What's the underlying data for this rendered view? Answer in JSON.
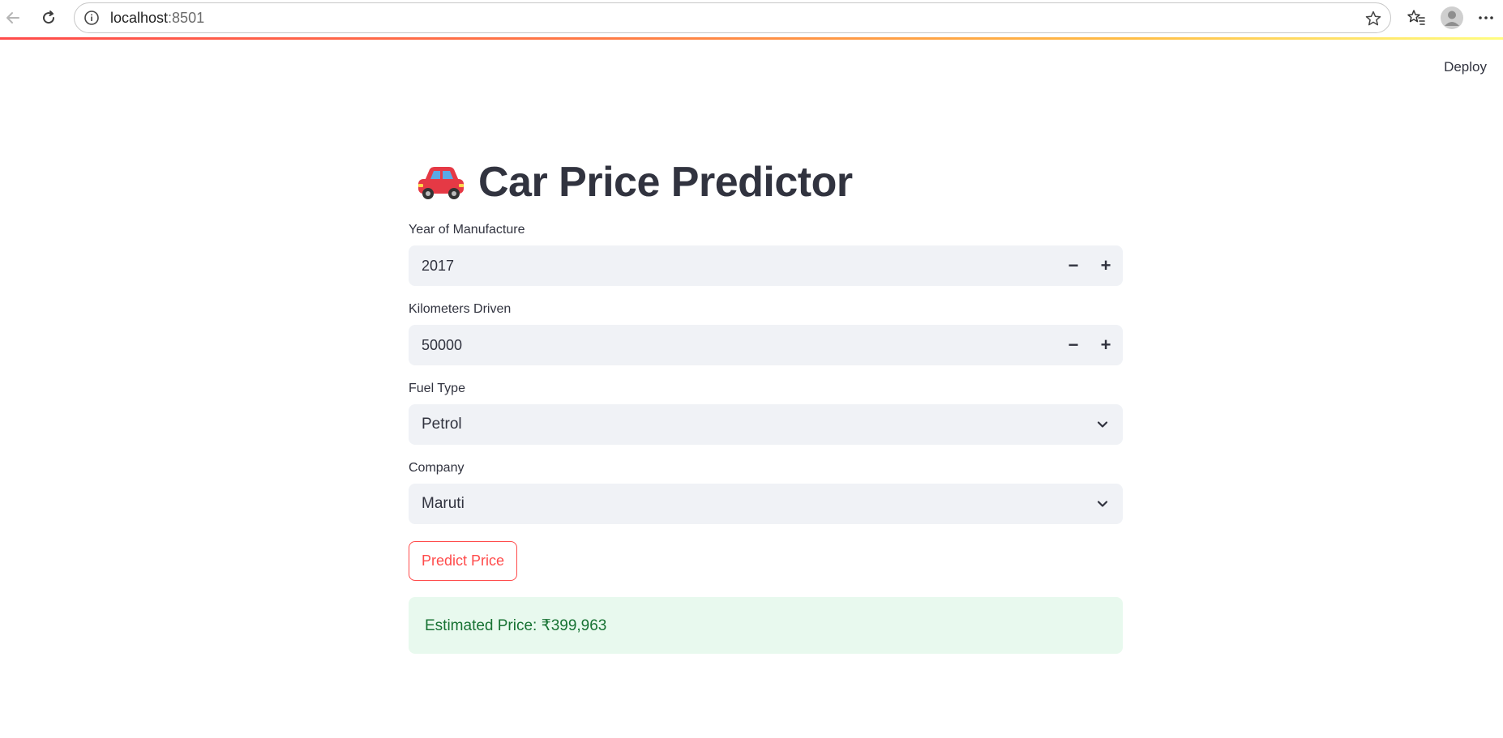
{
  "browser": {
    "address_host": "localhost",
    "address_port": ":8501",
    "icons": [
      "back-arrow-icon",
      "reload-icon",
      "info-icon",
      "star-icon",
      "favorites-icon",
      "profile-icon",
      "more-icon"
    ]
  },
  "header": {
    "deploy_label": "Deploy"
  },
  "main": {
    "title": "Car Price Predictor",
    "title_icon": "car-icon",
    "fields": {
      "year": {
        "label": "Year of Manufacture",
        "value": "2017"
      },
      "km": {
        "label": "Kilometers Driven",
        "value": "50000"
      },
      "fuel": {
        "label": "Fuel Type",
        "value": "Petrol"
      },
      "company": {
        "label": "Company",
        "value": "Maruti"
      }
    },
    "stepper_minus": "−",
    "stepper_plus": "+",
    "predict_label": "Predict Price",
    "result_text": "Estimated Price: ₹399,963"
  },
  "colors": {
    "accent": "#ff4b4b",
    "input_bg": "#f0f2f6",
    "success_bg": "#e8f9ee",
    "success_text": "#177233",
    "text": "#31333f"
  }
}
